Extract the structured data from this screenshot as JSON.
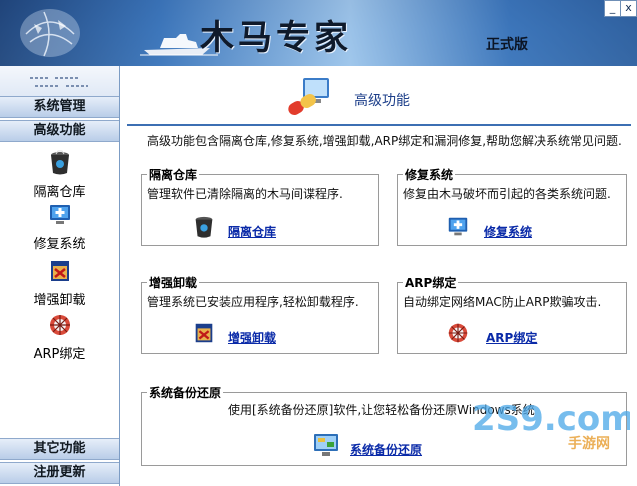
{
  "window": {
    "title": "木马专家",
    "edition": "正式版",
    "minimize_label": "_",
    "close_label": "x"
  },
  "sidebar": {
    "top_section": "系统管理",
    "active_section": "高级功能",
    "items": [
      {
        "label": "隔离仓库",
        "icon": "trash-bin-icon"
      },
      {
        "label": "修复系统",
        "icon": "repair-monitor-icon"
      },
      {
        "label": "增强卸载",
        "icon": "uninstall-box-icon"
      },
      {
        "label": "ARP绑定",
        "icon": "network-bug-icon"
      }
    ],
    "bottom_sections": [
      "其它功能",
      "注册更新"
    ]
  },
  "main": {
    "title": "高级功能",
    "intro": "高级功能包含隔离仓库,修复系统,增强卸载,ARP绑定和漏洞修复,帮助您解决系统常见问题.",
    "panels": [
      {
        "title": "隔离仓库",
        "desc": "管理软件已清除隔离的木马间谍程序.",
        "link": "隔离仓库",
        "icon": "trash-bin-icon"
      },
      {
        "title": "修复系统",
        "desc": "修复由木马破坏而引起的各类系统问题.",
        "link": "修复系统",
        "icon": "repair-monitor-icon"
      },
      {
        "title": "增强卸载",
        "desc": "管理系统已安装应用程序,轻松卸载程序.",
        "link": "增强卸载",
        "icon": "uninstall-box-icon"
      },
      {
        "title": "ARP绑定",
        "desc": "自动绑定网络MAC防止ARP欺骗攻击.",
        "link": "ARP绑定",
        "icon": "network-bug-icon"
      },
      {
        "title": "系统备份还原",
        "desc": "使用[系统备份还原]软件,让您轻松备份还原Windows系统",
        "link": "系统备份还原",
        "icon": "backup-monitor-icon"
      }
    ]
  },
  "watermark": {
    "text": "2S9.com",
    "subtext": "手游网"
  },
  "colors": {
    "accent": "#3c6fb3",
    "link": "#0a2aa8",
    "header": "#4c86c8"
  }
}
